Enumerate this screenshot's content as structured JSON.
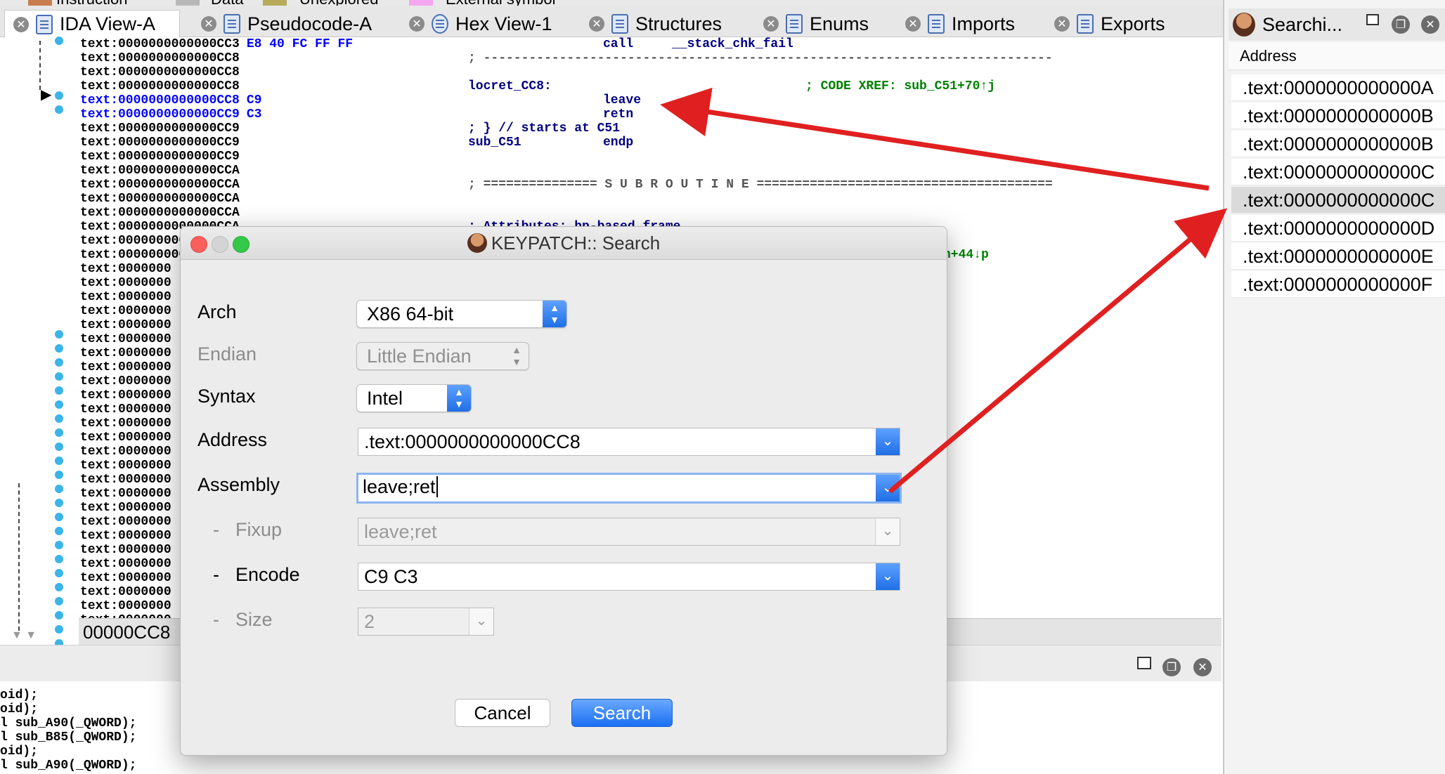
{
  "legend": [
    "Instruction",
    "Data",
    "Unexplored",
    "External symbol"
  ],
  "legend_colors": [
    "#c87d50",
    "#b8b8b8",
    "#b8ab5a",
    "#f5a6f0"
  ],
  "tabs": [
    {
      "label": "IDA View-A",
      "icon": "ida-view-icon",
      "active": true
    },
    {
      "label": "Pseudocode-A",
      "icon": "pseudocode-icon"
    },
    {
      "label": "Hex View-1",
      "icon": "hex-view-icon"
    },
    {
      "label": "Structures",
      "icon": "structures-icon"
    },
    {
      "label": "Enums",
      "icon": "enums-icon"
    },
    {
      "label": "Imports",
      "icon": "imports-icon"
    },
    {
      "label": "Exports",
      "icon": "exports-icon"
    }
  ],
  "disasm": {
    "lines": [
      {
        "addr": "text:0000000000000CC3",
        "bytes": "E8 40 FC FF FF",
        "mn": "call",
        "op": "__stack_chk_fail"
      },
      {
        "addr": "text:0000000000000CC8",
        "rule": "; ---------------------------------------------------------------------------"
      },
      {
        "addr": "text:0000000000000CC8"
      },
      {
        "addr": "text:0000000000000CC8",
        "label": "locret_CC8:",
        "comment": "; CODE XREF: sub_C51+70↑j"
      },
      {
        "addr": "text:0000000000000CC8",
        "bytes": "C9",
        "mn": "leave",
        "hl": true
      },
      {
        "addr": "text:0000000000000CC9",
        "bytes": "C3",
        "mn": "retn",
        "hl": true
      },
      {
        "addr": "text:0000000000000CC9",
        "label": "; } // starts at C51"
      },
      {
        "addr": "text:0000000000000CC9",
        "label": "sub_C51",
        "mn": "endp"
      },
      {
        "addr": "text:0000000000000CC9"
      },
      {
        "addr": "text:0000000000000CCA"
      },
      {
        "addr": "text:0000000000000CCA",
        "rule": "; =============== S U B R O U T I N E ======================================="
      },
      {
        "addr": "text:0000000000000CCA"
      },
      {
        "addr": "text:0000000000000CCA"
      },
      {
        "addr": "text:0000000000000CCA",
        "label": "; Attributes: bp-based frame"
      },
      {
        "addr": "text:0000000000000CCA"
      },
      {
        "addr": "text:0000000000000CCA",
        "comment_right": "n+44↓p"
      }
    ],
    "truncated_addr": "text:0000000",
    "truncated_rows": 27
  },
  "status_addr": "00000CC8",
  "output_lines": [
    "oid);",
    "oid);",
    "l sub_A90(_QWORD);",
    "l sub_B85(_QWORD);",
    "oid);",
    "l sub_A90(_QWORD);"
  ],
  "search_panel": {
    "title": "Searchi...",
    "column": "Address",
    "rows": [
      ".text:0000000000000A",
      ".text:0000000000000B",
      ".text:0000000000000B",
      ".text:0000000000000C",
      ".text:0000000000000C",
      ".text:0000000000000D",
      ".text:0000000000000E",
      ".text:0000000000000F"
    ],
    "selected_index": 4
  },
  "dialog": {
    "title": "KEYPATCH:: Search",
    "arch_label": "Arch",
    "arch_value": "X86 64-bit",
    "endian_label": "Endian",
    "endian_value": "Little Endian",
    "syntax_label": "Syntax",
    "syntax_value": "Intel",
    "address_label": "Address",
    "address_value": ".text:0000000000000CC8",
    "assembly_label": "Assembly",
    "assembly_value": "leave;ret",
    "fixup_label": "Fixup",
    "fixup_value": "leave;ret",
    "encode_label": "Encode",
    "encode_value": "C9 C3",
    "size_label": "Size",
    "size_value": "2",
    "dash": "-",
    "cancel_label": "Cancel",
    "search_label": "Search"
  },
  "colors": {
    "accent": "#1f6fe6",
    "arrow": "#e02020",
    "close_red": "#fc605c",
    "min_gray": "#cfcfcf",
    "max_green": "#34c84a"
  }
}
